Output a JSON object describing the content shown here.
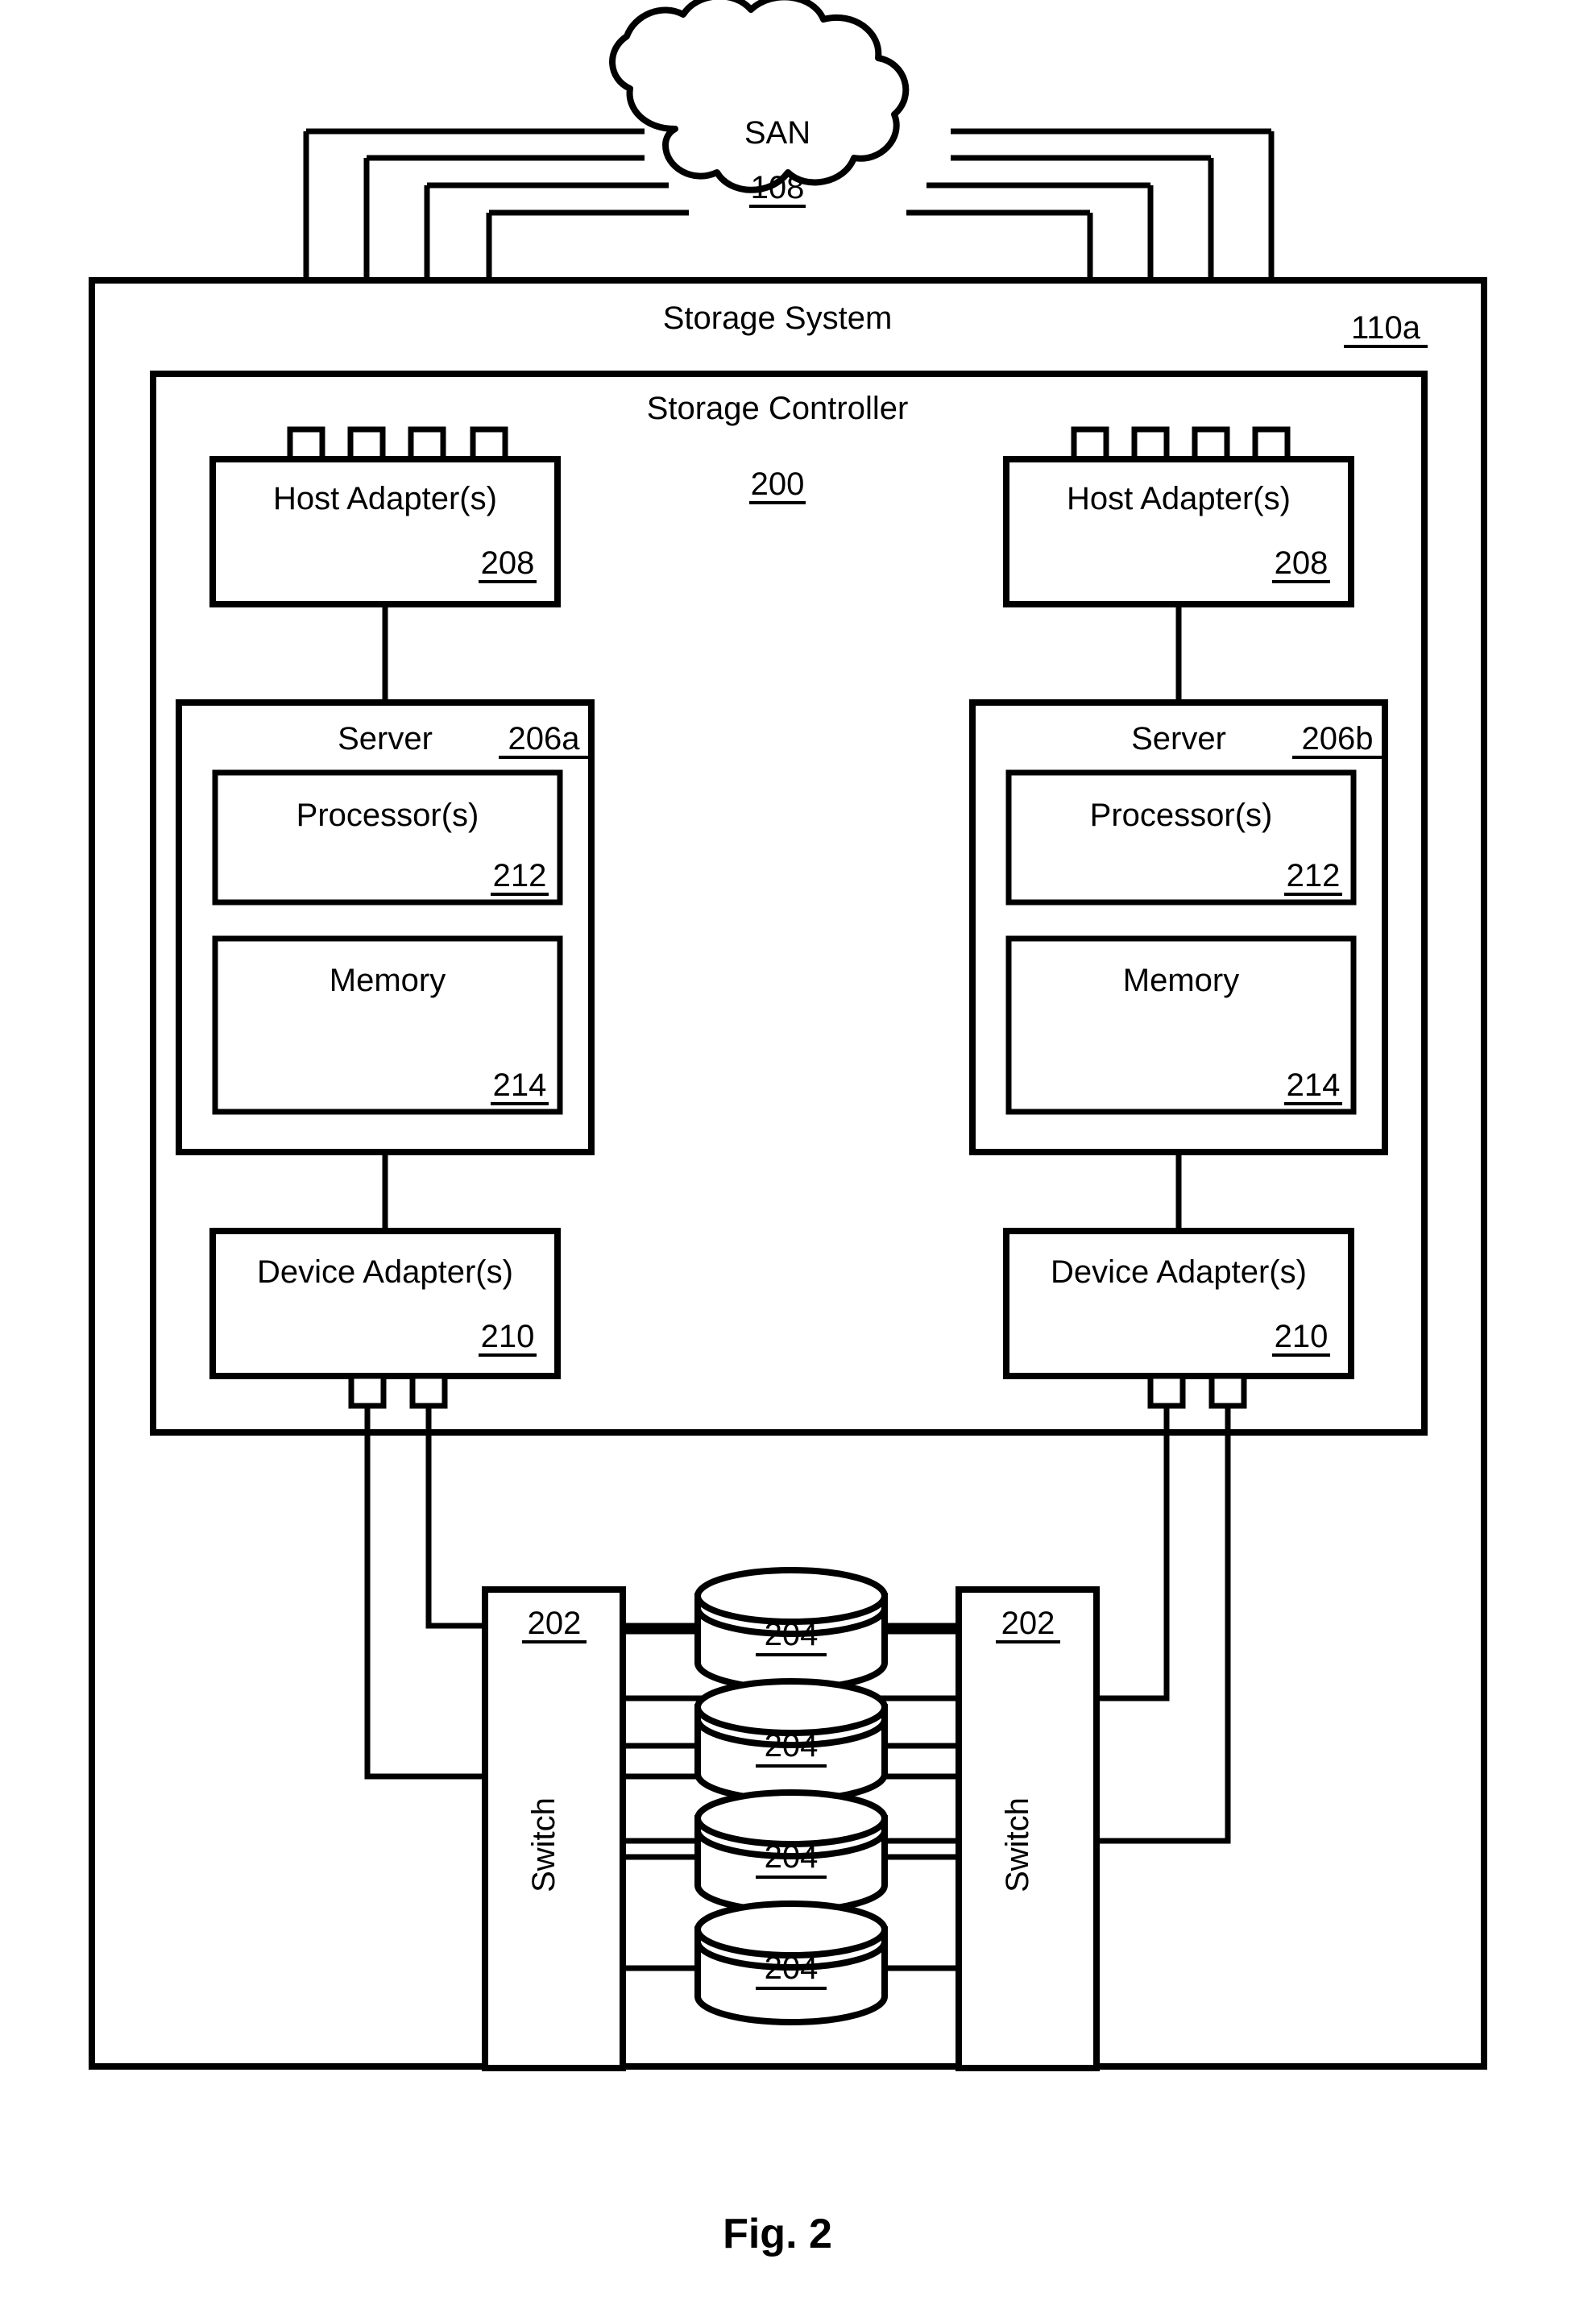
{
  "figure": {
    "caption": "Fig. 2"
  },
  "network": {
    "cloud_label": "SAN",
    "cloud_ref": "108"
  },
  "storage_system": {
    "title": "Storage System",
    "ref": "110a"
  },
  "storage_controller": {
    "title": "Storage Controller",
    "ref": "200"
  },
  "host_adapters": [
    {
      "label": "Host Adapter(s)",
      "ref": "208",
      "side": "left",
      "port_count": 4
    },
    {
      "label": "Host Adapter(s)",
      "ref": "208",
      "side": "right",
      "port_count": 4
    }
  ],
  "servers": [
    {
      "label": "Server",
      "ref": "206a",
      "processor": {
        "label": "Processor(s)",
        "ref": "212"
      },
      "memory": {
        "label": "Memory",
        "ref": "214"
      }
    },
    {
      "label": "Server",
      "ref": "206b",
      "processor": {
        "label": "Processor(s)",
        "ref": "212"
      },
      "memory": {
        "label": "Memory",
        "ref": "214"
      }
    }
  ],
  "device_adapters": [
    {
      "label": "Device Adapter(s)",
      "ref": "210",
      "side": "left",
      "port_count": 2
    },
    {
      "label": "Device Adapter(s)",
      "ref": "210",
      "side": "right",
      "port_count": 2
    }
  ],
  "switches": [
    {
      "label": "Switch",
      "ref": "202",
      "side": "left"
    },
    {
      "label": "Switch",
      "ref": "202",
      "side": "right"
    }
  ],
  "storage_drives": [
    {
      "ref": "204"
    },
    {
      "ref": "204"
    },
    {
      "ref": "204"
    },
    {
      "ref": "204"
    }
  ]
}
